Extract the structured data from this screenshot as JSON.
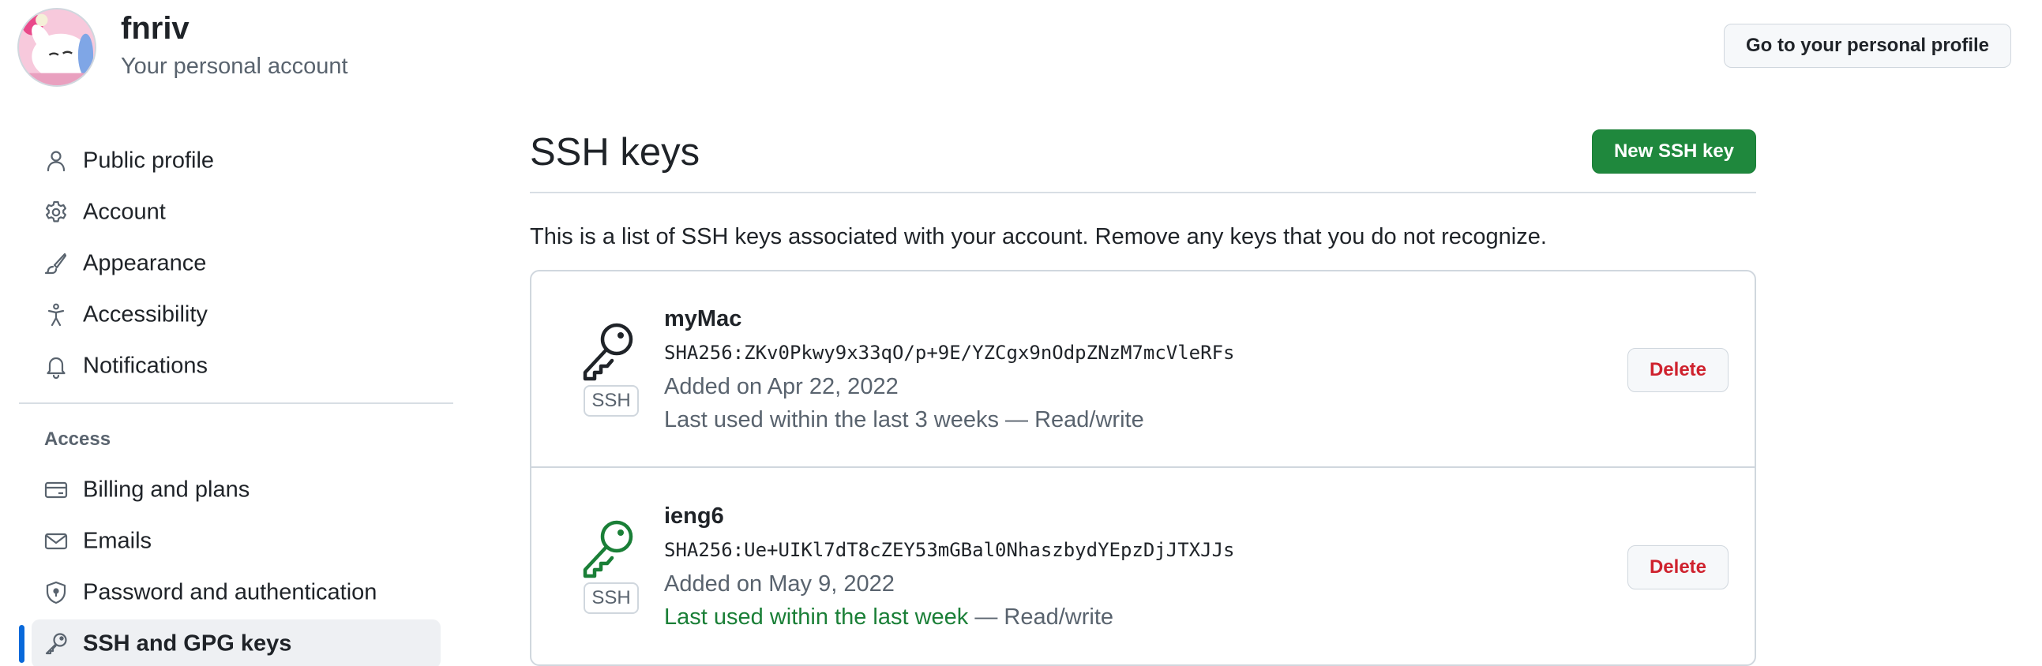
{
  "header": {
    "username": "fnriv",
    "subtitle": "Your personal account",
    "profile_button": "Go to your personal profile"
  },
  "sidebar": {
    "items": [
      {
        "label": "Public profile",
        "icon": "person-icon"
      },
      {
        "label": "Account",
        "icon": "gear-icon"
      },
      {
        "label": "Appearance",
        "icon": "paintbrush-icon"
      },
      {
        "label": "Accessibility",
        "icon": "accessibility-icon"
      },
      {
        "label": "Notifications",
        "icon": "bell-icon"
      }
    ],
    "access_heading": "Access",
    "access_items": [
      {
        "label": "Billing and plans",
        "icon": "credit-card-icon"
      },
      {
        "label": "Emails",
        "icon": "mail-icon"
      },
      {
        "label": "Password and authentication",
        "icon": "shield-lock-icon"
      },
      {
        "label": "SSH and GPG keys",
        "icon": "key-icon",
        "active": true
      }
    ]
  },
  "main": {
    "title": "SSH keys",
    "new_key_button": "New SSH key",
    "description": "This is a list of SSH keys associated with your account. Remove any keys that you do not recognize.",
    "keys": [
      {
        "name": "myMac",
        "fingerprint": "SHA256:ZKv0Pkwy9x33qO/p+9E/YZCgx9nOdpZNzM7mcVleRFs",
        "added": "Added on Apr 22, 2022",
        "last_used": "Last used within the last 3 weeks",
        "access": "— Read/write",
        "badge": "SSH",
        "delete_label": "Delete",
        "icon_color": "#1f2328"
      },
      {
        "name": "ieng6",
        "fingerprint": "SHA256:Ue+UIKl7dT8cZEY53mGBal0NhaszbydYEpzDjJTXJJs",
        "added": "Added on May 9, 2022",
        "last_used": "Last used within the last week",
        "access": "— Read/write",
        "badge": "SSH",
        "delete_label": "Delete",
        "icon_color": "#1a7f37"
      }
    ]
  },
  "colors": {
    "accent_blue": "#0969da",
    "primary_green": "#1f883d",
    "danger_red": "#cf222e",
    "recent_green": "#1a7f37"
  }
}
